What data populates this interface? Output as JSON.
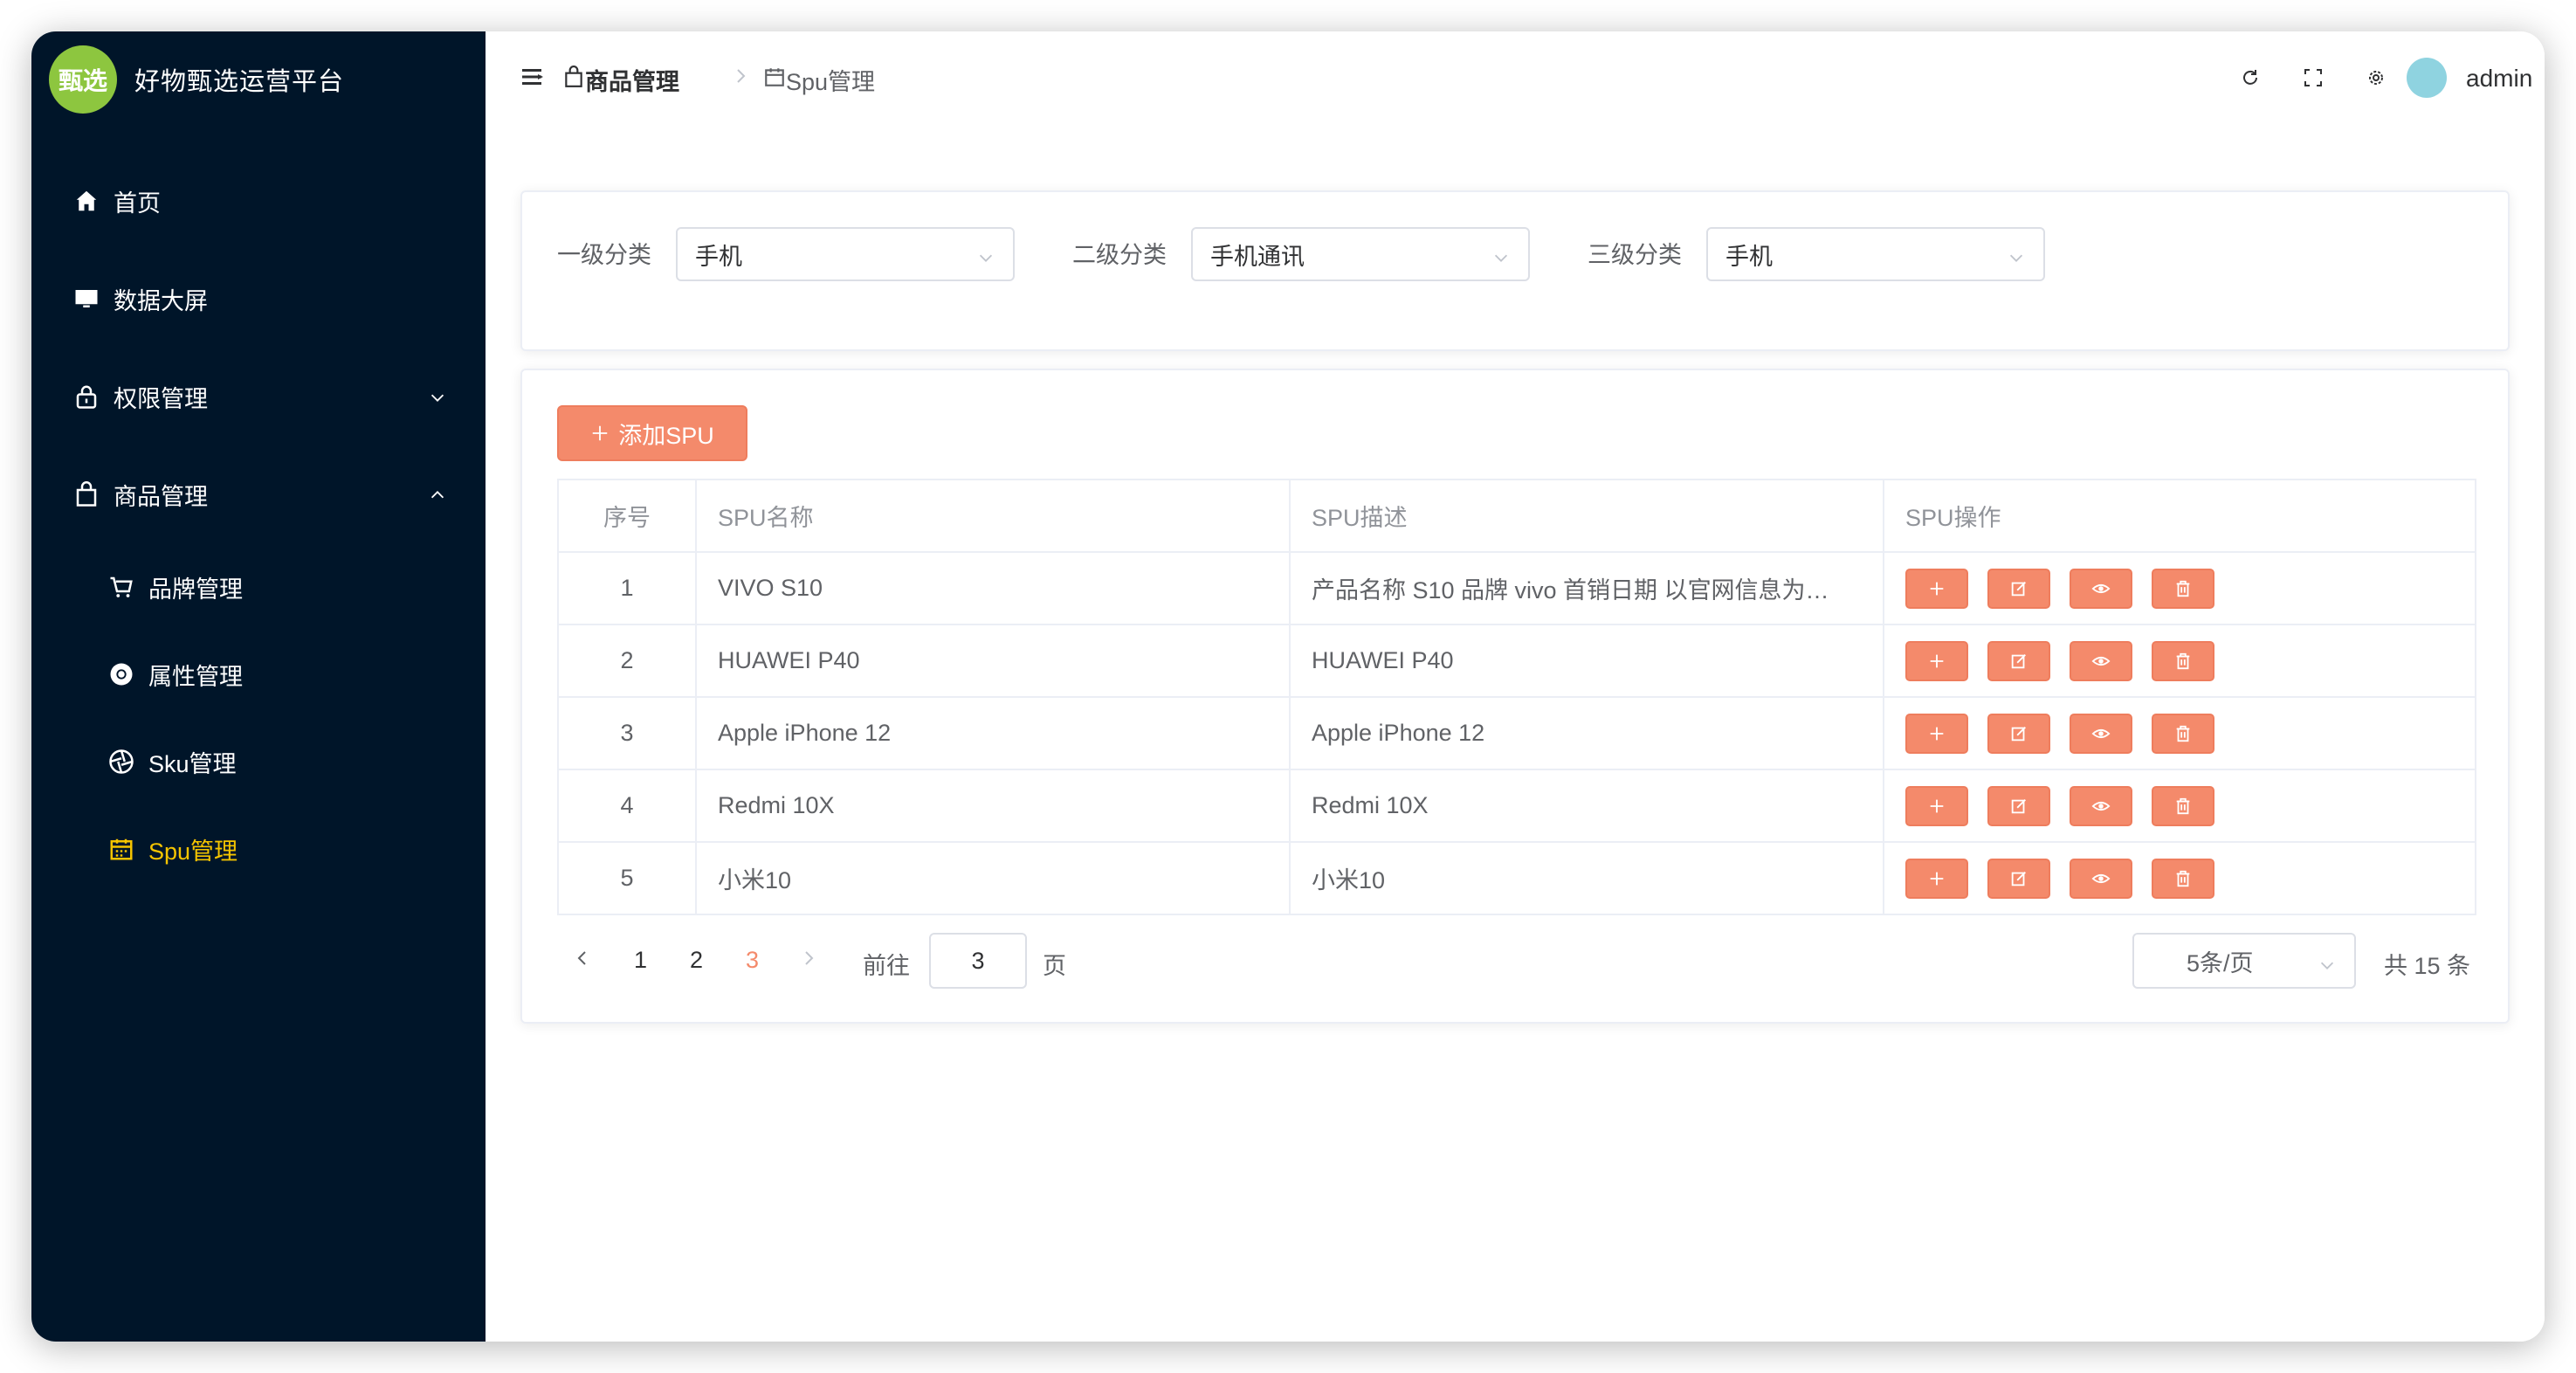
{
  "app": {
    "logo_text": "甄选",
    "title": "好物甄选运营平台"
  },
  "sidebar": {
    "items": [
      {
        "label": "首页",
        "icon": "home-icon"
      },
      {
        "label": "数据大屏",
        "icon": "monitor-icon"
      },
      {
        "label": "权限管理",
        "icon": "lock-icon",
        "expanded": false
      },
      {
        "label": "商品管理",
        "icon": "bag-icon",
        "expanded": true
      },
      {
        "label": "品牌管理",
        "icon": "cart-icon"
      },
      {
        "label": "属性管理",
        "icon": "chrome-icon"
      },
      {
        "label": "Sku管理",
        "icon": "aperture-icon"
      },
      {
        "label": "Spu管理",
        "icon": "calendar-icon",
        "active": true
      }
    ]
  },
  "header": {
    "breadcrumb": [
      "商品管理",
      "Spu管理"
    ],
    "username": "admin"
  },
  "filters": [
    {
      "label": "一级分类",
      "value": "手机"
    },
    {
      "label": "二级分类",
      "value": "手机通讯"
    },
    {
      "label": "三级分类",
      "value": "手机"
    }
  ],
  "toolbar": {
    "add_label": "添加SPU"
  },
  "table": {
    "columns": [
      "序号",
      "SPU名称",
      "SPU描述",
      "SPU操作"
    ],
    "rows": [
      {
        "index": "1",
        "name": "VIVO S10",
        "desc": "产品名称 S10 品牌 vivo 首销日期 以官网信息为…"
      },
      {
        "index": "2",
        "name": "HUAWEI P40",
        "desc": "HUAWEI P40"
      },
      {
        "index": "3",
        "name": "Apple iPhone 12",
        "desc": "Apple iPhone 12"
      },
      {
        "index": "4",
        "name": "Redmi 10X",
        "desc": "Redmi 10X"
      },
      {
        "index": "5",
        "name": "小米10",
        "desc": "小米10"
      }
    ]
  },
  "pagination": {
    "pages": [
      "1",
      "2",
      "3"
    ],
    "current": "3",
    "goto_label": "前往",
    "goto_value": "3",
    "page_unit": "页",
    "page_size": "5条/页",
    "total": "共 15 条"
  },
  "colors": {
    "sidebar_bg": "#001529",
    "active_menu": "#f5c400",
    "primary_btn": "#f48a6b"
  }
}
